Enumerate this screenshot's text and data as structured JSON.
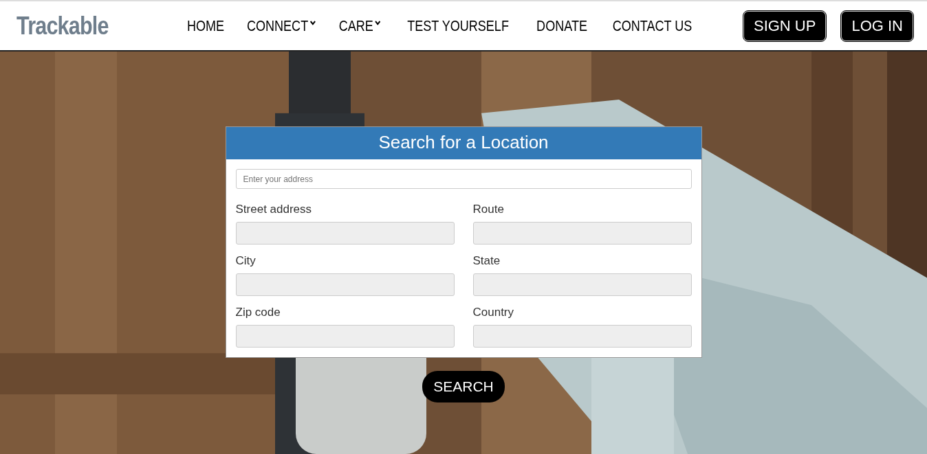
{
  "header": {
    "brand": "Trackable",
    "nav": [
      {
        "label": "HOME",
        "dropdown": false
      },
      {
        "label": "CONNECT",
        "dropdown": true
      },
      {
        "label": "CARE",
        "dropdown": true
      },
      {
        "label": "TEST YOURSELF",
        "dropdown": false
      },
      {
        "label": "DONATE",
        "dropdown": false
      },
      {
        "label": "CONTACT US",
        "dropdown": false
      }
    ],
    "buttons": [
      "SIGN UP",
      "LOG IN"
    ]
  },
  "form": {
    "title": "Search for a Location",
    "address": {
      "placeholder": "Enter your address"
    },
    "fields": [
      {
        "label": "Street address",
        "disabled": true
      },
      {
        "label": "Route",
        "disabled": true
      },
      {
        "label": "City",
        "disabled": true
      },
      {
        "label": "State",
        "disabled": true
      },
      {
        "label": "Zip code",
        "disabled": true
      },
      {
        "label": "Country",
        "disabled": true
      }
    ]
  },
  "search_button": "SEARCH"
}
